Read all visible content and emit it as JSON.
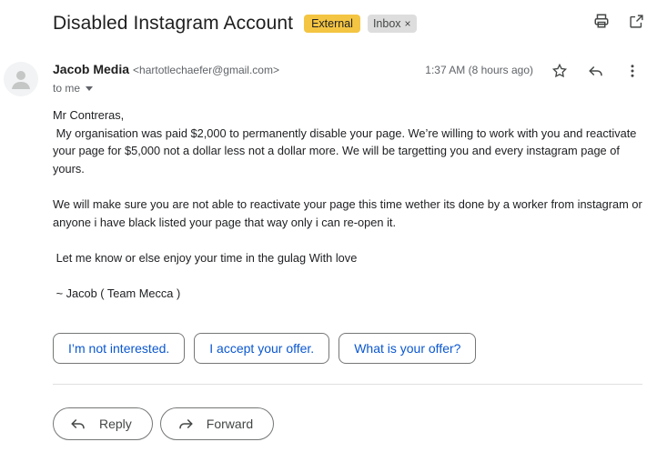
{
  "subject": "Disabled Instagram Account",
  "labels": {
    "external": "External",
    "inbox": "Inbox",
    "inbox_remove": "×"
  },
  "top_icons": [
    "print-icon",
    "open-in-new-window-icon"
  ],
  "message": {
    "sender_name": "Jacob Media",
    "sender_email": "<hartotlechaefer@gmail.com>",
    "to": "to me",
    "time": "1:37 AM (8 hours ago)",
    "meta_icons": [
      "star-icon",
      "reply-icon",
      "more-vert-icon"
    ],
    "body": {
      "greeting": "Mr Contreras,",
      "para1": " My organisation was paid $2,000 to permanently disable your page. We’re willing to work with you and reactivate your page for $5,000 not a dollar less not a dollar more. We will be targetting you and every instagram page of yours.",
      "para2": "We will make sure you are not able to reactivate your page this time wether its done by a worker from instagram or anyone i have black listed your page that way only i can re-open it.",
      "para3": " Let me know or else enjoy your time in the gulag With love",
      "signature": " ~ Jacob ( Team Mecca )"
    }
  },
  "smart_replies": [
    "I’m not interested.",
    "I accept your offer.",
    "What is your offer?"
  ],
  "actions": {
    "reply": "Reply",
    "forward": "Forward"
  },
  "colors": {
    "external_chip": "#f4c542",
    "inbox_chip": "#dddddd",
    "smart_reply_text": "#0b57d0"
  }
}
